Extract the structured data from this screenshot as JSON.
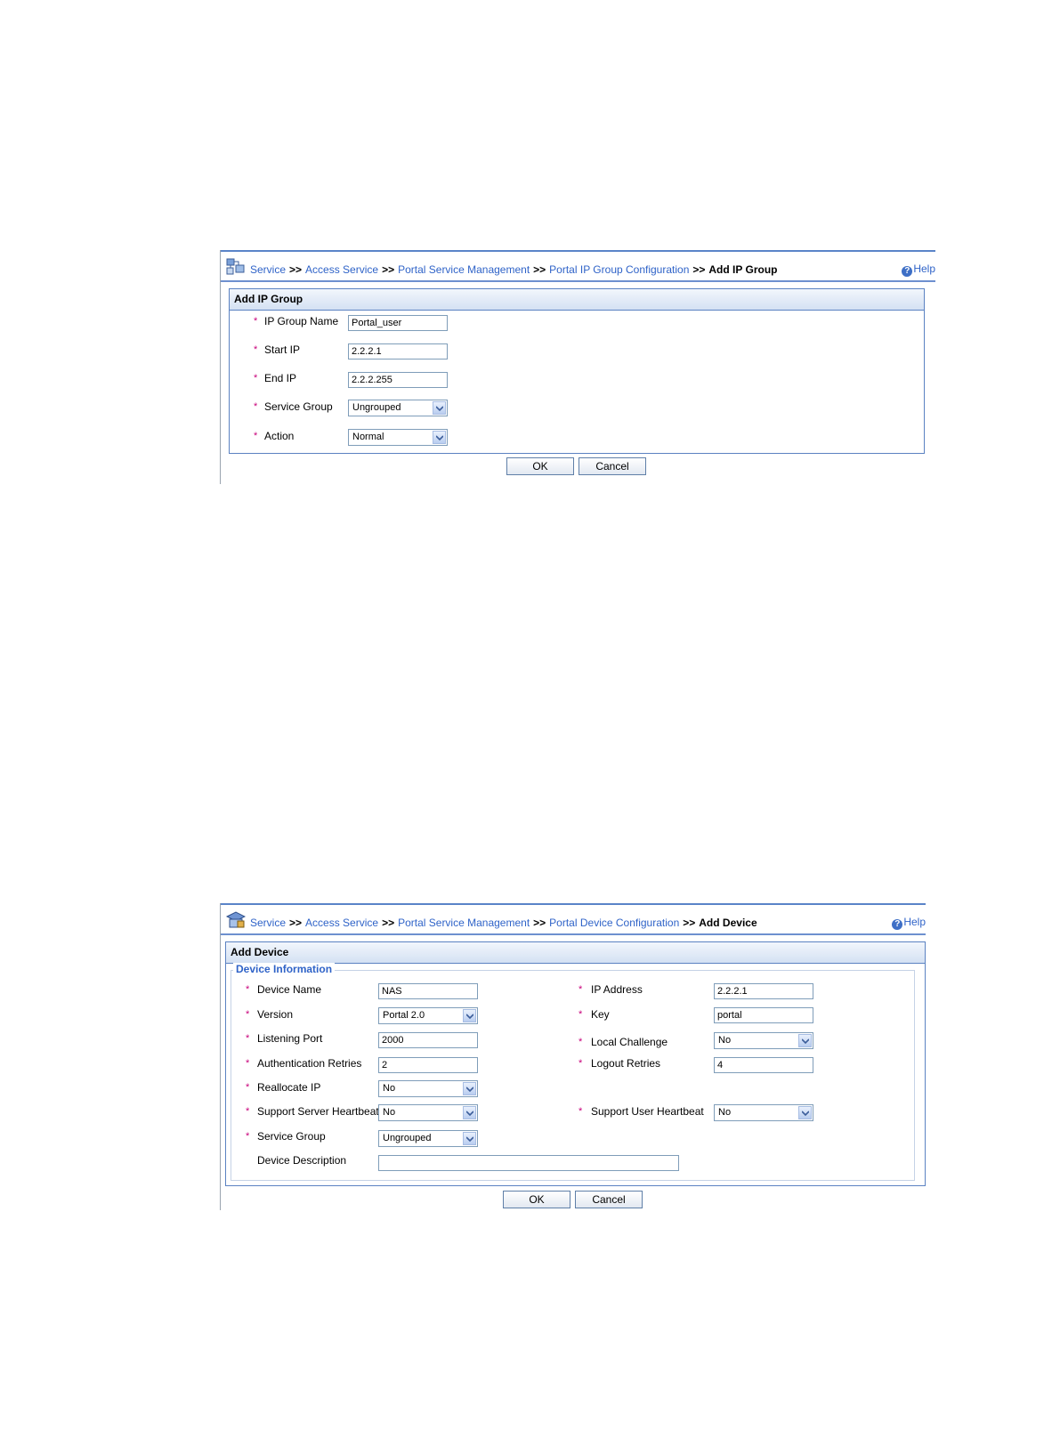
{
  "top": {
    "breadcrumb": {
      "items": [
        "Service",
        "Access Service",
        "Portal Service Management",
        "Portal IP Group Configuration"
      ],
      "separator": ">>",
      "current": "Add IP Group"
    },
    "help": "Help",
    "panel_title": "Add IP Group",
    "fields": {
      "ip_group_name": {
        "label": "IP Group Name",
        "value": "Portal_user"
      },
      "start_ip": {
        "label": "Start IP",
        "value": "2.2.2.1"
      },
      "end_ip": {
        "label": "End IP",
        "value": "2.2.2.255"
      },
      "service_group": {
        "label": "Service Group",
        "value": "Ungrouped"
      },
      "action": {
        "label": "Action",
        "value": "Normal"
      }
    },
    "required_mark": "*",
    "ok": "OK",
    "cancel": "Cancel"
  },
  "bottom": {
    "breadcrumb": {
      "items": [
        "Service",
        "Access Service",
        "Portal Service Management",
        "Portal Device Configuration"
      ],
      "separator": ">>",
      "current": "Add Device"
    },
    "help": "Help",
    "panel_title": "Add Device",
    "section_title": "Device Information",
    "fields": {
      "device_name": {
        "label": "Device Name",
        "value": "NAS"
      },
      "version": {
        "label": "Version",
        "value": "Portal 2.0"
      },
      "listening_port": {
        "label": "Listening Port",
        "value": "2000"
      },
      "auth_retries": {
        "label": "Authentication Retries",
        "value": "2"
      },
      "reallocate_ip": {
        "label": "Reallocate IP",
        "value": "No"
      },
      "server_heartbeat": {
        "label": "Support Server Heartbeat",
        "value": "No"
      },
      "service_group": {
        "label": "Service Group",
        "value": "Ungrouped"
      },
      "device_description": {
        "label": "Device Description",
        "value": ""
      },
      "ip_address": {
        "label": "IP Address",
        "value": "2.2.2.1"
      },
      "key": {
        "label": "Key",
        "value": "portal"
      },
      "local_challenge": {
        "label": "Local Challenge",
        "value": "No"
      },
      "logout_retries": {
        "label": "Logout Retries",
        "value": "4"
      },
      "user_heartbeat": {
        "label": "Support User Heartbeat",
        "value": "No"
      }
    },
    "required_mark": "*",
    "ok": "OK",
    "cancel": "Cancel"
  },
  "colors": {
    "link": "#2f63c8",
    "required": "#c8007a",
    "border": "#5b82c2"
  }
}
